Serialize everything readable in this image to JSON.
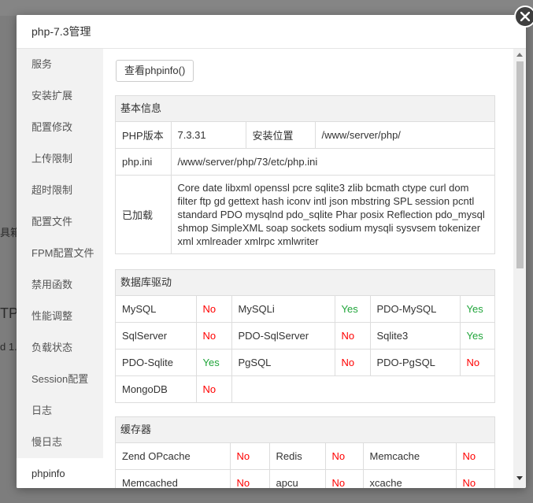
{
  "modal": {
    "title": "php-7.3管理"
  },
  "sidebar": {
    "items": [
      {
        "label": "服务"
      },
      {
        "label": "安装扩展"
      },
      {
        "label": "配置修改"
      },
      {
        "label": "上传限制"
      },
      {
        "label": "超时限制"
      },
      {
        "label": "配置文件"
      },
      {
        "label": "FPM配置文件"
      },
      {
        "label": "禁用函数"
      },
      {
        "label": "性能调整"
      },
      {
        "label": "负载状态"
      },
      {
        "label": "Session配置"
      },
      {
        "label": "日志"
      },
      {
        "label": "慢日志"
      },
      {
        "label": "phpinfo"
      }
    ],
    "active": "phpinfo"
  },
  "toolbar": {
    "phpinfo_button": "查看phpinfo()"
  },
  "basic": {
    "title": "基本信息",
    "version_label": "PHP版本",
    "version": "7.3.31",
    "install_label": "安装位置",
    "install_path": "/www/server/php/",
    "ini_label": "php.ini",
    "ini_path": "/www/server/php/73/etc/php.ini",
    "loaded_label": "已加载",
    "loaded_extensions": "Core date libxml openssl pcre sqlite3 zlib bcmath ctype curl dom filter ftp gd gettext hash iconv intl json mbstring SPL session pcntl standard PDO mysqlnd pdo_sqlite Phar posix Reflection pdo_mysql shmop SimpleXML soap sockets sodium mysqli sysvsem tokenizer xml xmlreader xmlrpc xmlwriter"
  },
  "db": {
    "title": "数据库驱动",
    "rows": [
      [
        {
          "name": "MySQL",
          "status": "No"
        },
        {
          "name": "MySQLi",
          "status": "Yes"
        },
        {
          "name": "PDO-MySQL",
          "status": "Yes"
        }
      ],
      [
        {
          "name": "SqlServer",
          "status": "No"
        },
        {
          "name": "PDO-SqlServer",
          "status": "No"
        },
        {
          "name": "Sqlite3",
          "status": "Yes"
        }
      ],
      [
        {
          "name": "PDO-Sqlite",
          "status": "Yes"
        },
        {
          "name": "PgSQL",
          "status": "No"
        },
        {
          "name": "PDO-PgSQL",
          "status": "No"
        }
      ],
      [
        {
          "name": "MongoDB",
          "status": "No"
        }
      ]
    ]
  },
  "cache": {
    "title": "缓存器",
    "rows": [
      [
        {
          "name": "Zend OPcache",
          "status": "No"
        },
        {
          "name": "Redis",
          "status": "No"
        },
        {
          "name": "Memcache",
          "status": "No"
        }
      ],
      [
        {
          "name": "Memcached",
          "status": "No"
        },
        {
          "name": "apcu",
          "status": "No"
        },
        {
          "name": "xcache",
          "status": "No"
        }
      ]
    ]
  },
  "background": {
    "fragment_1": "具箱",
    "fragment_2": "TP",
    "fragment_3": "d 1."
  },
  "colors": {
    "yes": "#20a53a",
    "no": "#ff0000",
    "accent": "#20a53a"
  }
}
